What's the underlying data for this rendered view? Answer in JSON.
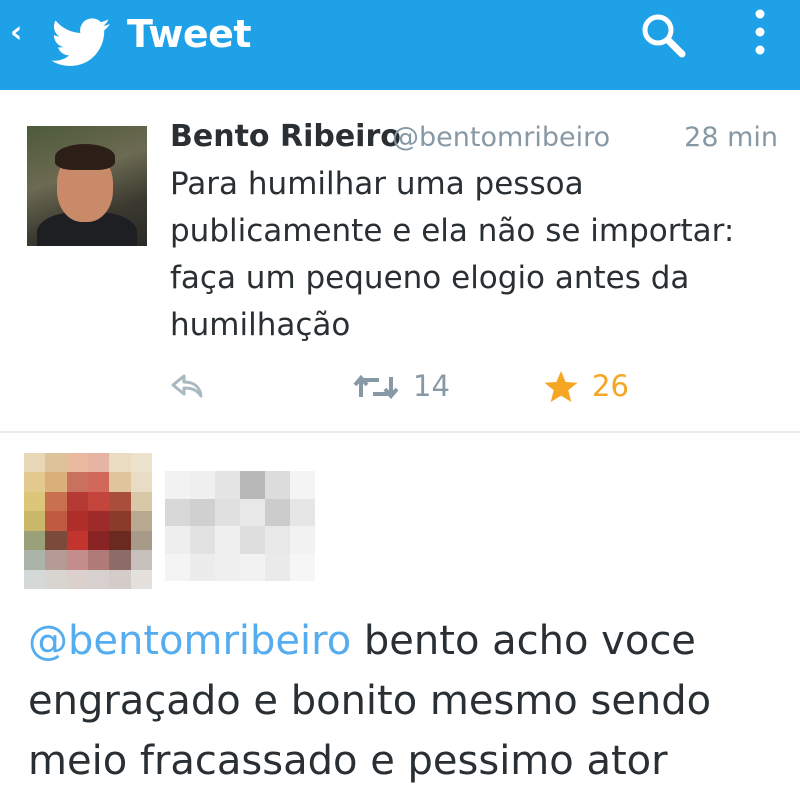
{
  "header": {
    "title": "Tweet",
    "back_icon": "chevron-left-icon",
    "logo_icon": "twitter-bird-icon",
    "search_icon": "search-icon",
    "menu_icon": "more-vertical-icon",
    "background_color": "#1fa1e8"
  },
  "tweet": {
    "author_name": "Bento Ribeiro",
    "author_handle": "@bentomribeiro",
    "time": "28 min",
    "text": "Para humilhar uma pessoa publicamente e ela não se importar: faça um pequeno elogio antes da humilhação",
    "retweet_count": "14",
    "favorite_count": "26",
    "favorite_color": "#f5a623"
  },
  "reply": {
    "mention": "@bentomribeiro",
    "text": " bento acho voce engraçado e bonito mesmo sendo meio fracassado e pessimo ator",
    "mention_color": "#55acee"
  }
}
